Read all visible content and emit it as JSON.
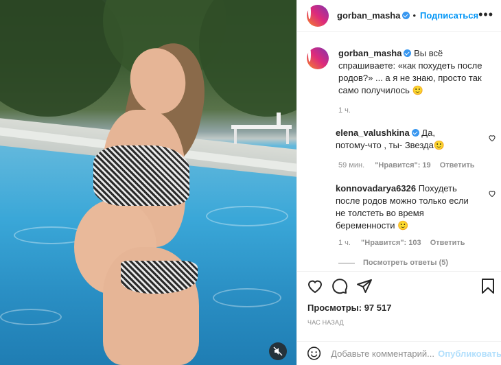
{
  "media": {
    "mute_icon": "mute-icon"
  },
  "header": {
    "username": "gorban_masha",
    "separator": "•",
    "follow_label": "Подписаться",
    "more_icon": "more-icon"
  },
  "caption": {
    "username": "gorban_masha",
    "text": "Вы всё спрашиваете: «как похудеть после родов?» ... а я не знаю, просто так само получилось 🙂",
    "time": "1 ч."
  },
  "comments": [
    {
      "username": "elena_valushkina",
      "verified": true,
      "text": "Да, потому-что , ты- Звезда🙂",
      "time": "59 мин.",
      "likes": "\"Нравится\": 19",
      "reply": "Ответить"
    },
    {
      "username": "konnovadarya6326",
      "verified": false,
      "text": "Похудеть после родов можно только если не толстеть во время беременности 🙂",
      "time": "1 ч.",
      "likes": "\"Нравится\": 103",
      "reply": "Ответить"
    }
  ],
  "view_replies": "Посмотреть ответы (5)",
  "stats": {
    "views": "Просмотры: 97 517",
    "time_ago": "час назад"
  },
  "add_comment": {
    "placeholder": "Добавьте комментарий...",
    "publish": "Опубликовать"
  },
  "colors": {
    "accent": "#0095f6",
    "verified": "#3897f0",
    "muted": "#8e8e8e"
  }
}
